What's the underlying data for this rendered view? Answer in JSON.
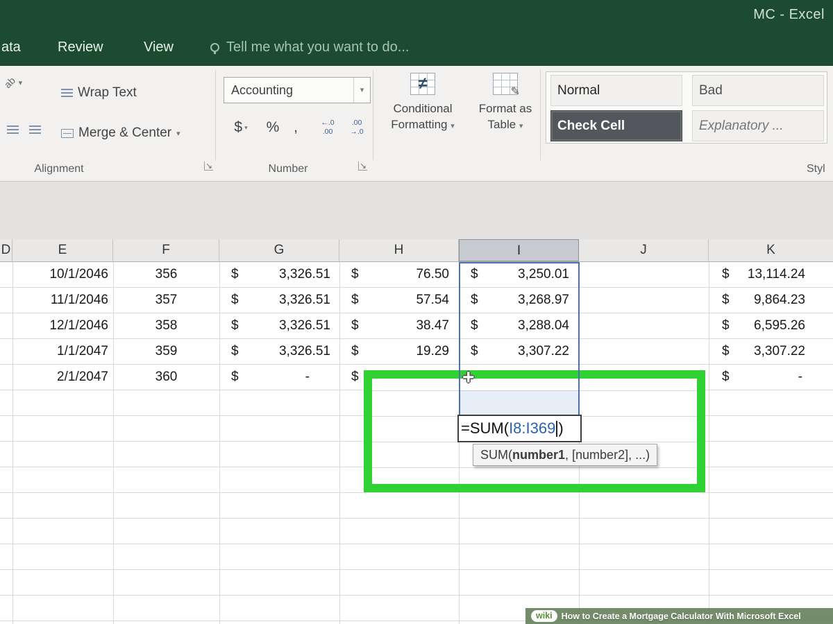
{
  "window": {
    "title": "MC - Excel"
  },
  "tabs": {
    "partial": "ata",
    "items": [
      "Review",
      "View"
    ],
    "tell_me": "Tell me what you want to do..."
  },
  "ribbon": {
    "alignment": {
      "wrap_text": "Wrap Text",
      "merge_center": "Merge & Center",
      "label": "Alignment"
    },
    "number": {
      "format_value": "Accounting",
      "currency": "$",
      "percent": "%",
      "comma": ",",
      "inc_decimal": [
        "←.0",
        ".00"
      ],
      "dec_decimal": [
        ".00",
        "→.0"
      ],
      "label": "Number"
    },
    "styles": {
      "conditional_line1": "Conditional",
      "conditional_line2": "Formatting",
      "format_table_line1": "Format as",
      "format_table_line2": "Table",
      "chips": [
        "Normal",
        "Bad",
        "Check Cell",
        "Explanatory ..."
      ],
      "label": "Styl"
    }
  },
  "sheet": {
    "currency": "$",
    "col_headers": [
      "D",
      "E",
      "F",
      "G",
      "H",
      "I",
      "J",
      "K"
    ],
    "rows": [
      {
        "date": "10/1/2046",
        "num": "356",
        "payment": "3,326.51",
        "interest": "76.50",
        "principal": "3,250.01",
        "balance": "13,114.24"
      },
      {
        "date": "11/1/2046",
        "num": "357",
        "payment": "3,326.51",
        "interest": "57.54",
        "principal": "3,268.97",
        "balance": "9,864.23"
      },
      {
        "date": "12/1/2046",
        "num": "358",
        "payment": "3,326.51",
        "interest": "38.47",
        "principal": "3,288.04",
        "balance": "6,595.26"
      },
      {
        "date": "1/1/2047",
        "num": "359",
        "payment": "3,326.51",
        "interest": "19.29",
        "principal": "3,307.22",
        "balance": "3,307.22"
      },
      {
        "date": "2/1/2047",
        "num": "360",
        "payment": "-",
        "interest": "",
        "principal": "",
        "balance": "-"
      }
    ]
  },
  "formula": {
    "before": "=SUM(",
    "range": "I8:I369",
    "after": ")"
  },
  "tooltip": {
    "before": "SUM(",
    "bold": "number1",
    "after": ", [number2], ...)"
  },
  "watermark": {
    "logo": "wiki",
    "text": "How to Create a Mortgage Calculator With Microsoft Excel"
  },
  "icons": {
    "caret": "▾",
    "launcher": "↘",
    "not_equal": "≠",
    "cell_cursor": "+",
    "orientation": "ab",
    "brush": "✎"
  },
  "colors": {
    "excel_green": "#1c4b30",
    "highlight_green": "#2fd133",
    "reference_blue": "#4a70b8"
  }
}
